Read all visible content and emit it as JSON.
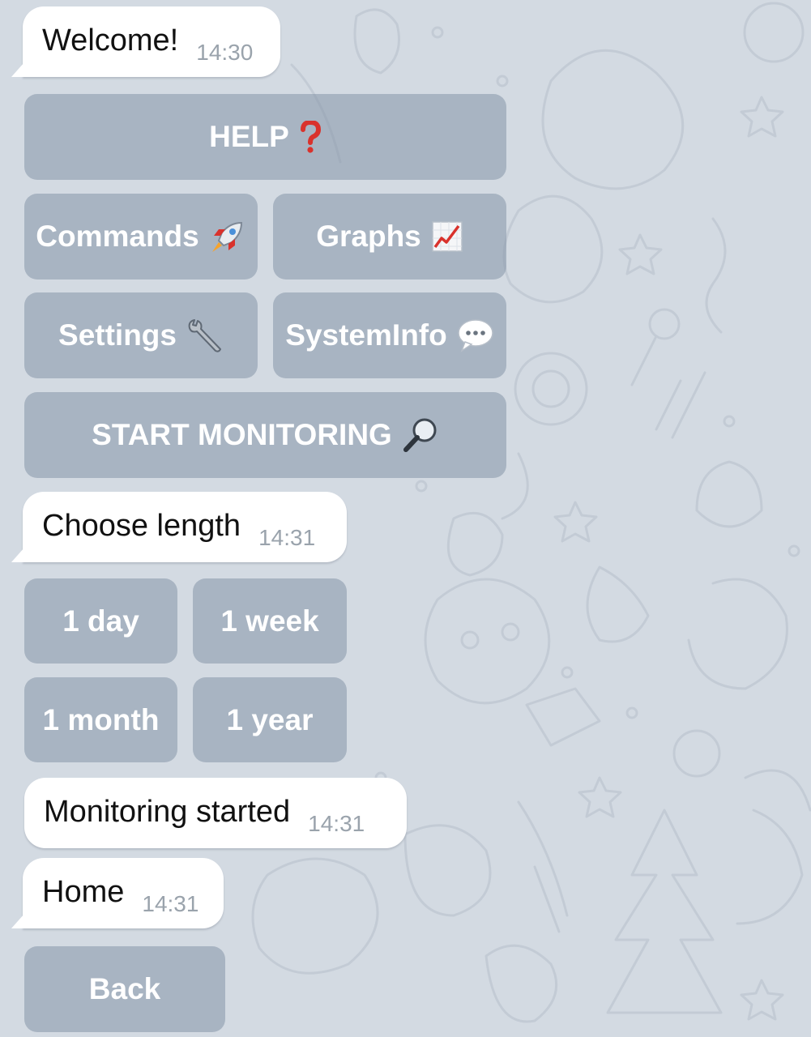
{
  "messages": {
    "welcome": {
      "text": "Welcome!",
      "time": "14:30"
    },
    "choose_length": {
      "text": "Choose length",
      "time": "14:31"
    },
    "monitoring_started": {
      "text": "Monitoring started",
      "time": "14:31"
    },
    "home": {
      "text": "Home",
      "time": "14:31"
    }
  },
  "keyboard_main": {
    "help": {
      "label": "HELP",
      "icon": "red-question-mark-icon"
    },
    "commands": {
      "label": "Commands",
      "icon": "rocket-icon"
    },
    "graphs": {
      "label": "Graphs",
      "icon": "chart-increasing-icon"
    },
    "settings": {
      "label": "Settings",
      "icon": "wrench-icon"
    },
    "system_info": {
      "label": "SystemInfo",
      "icon": "speech-bubble-icon"
    },
    "start_monitoring": {
      "label": "START MONITORING",
      "icon": "magnifying-glass-icon"
    }
  },
  "keyboard_length": {
    "day": "1 day",
    "week": "1 week",
    "month": "1 month",
    "year": "1 year"
  },
  "keyboard_home": {
    "back": "Back"
  },
  "colors": {
    "background": "#d3dae2",
    "bubble": "#ffffff",
    "button": "#9fabb8",
    "timestamp": "#9aa3ac",
    "help_icon": "#d9322c"
  }
}
